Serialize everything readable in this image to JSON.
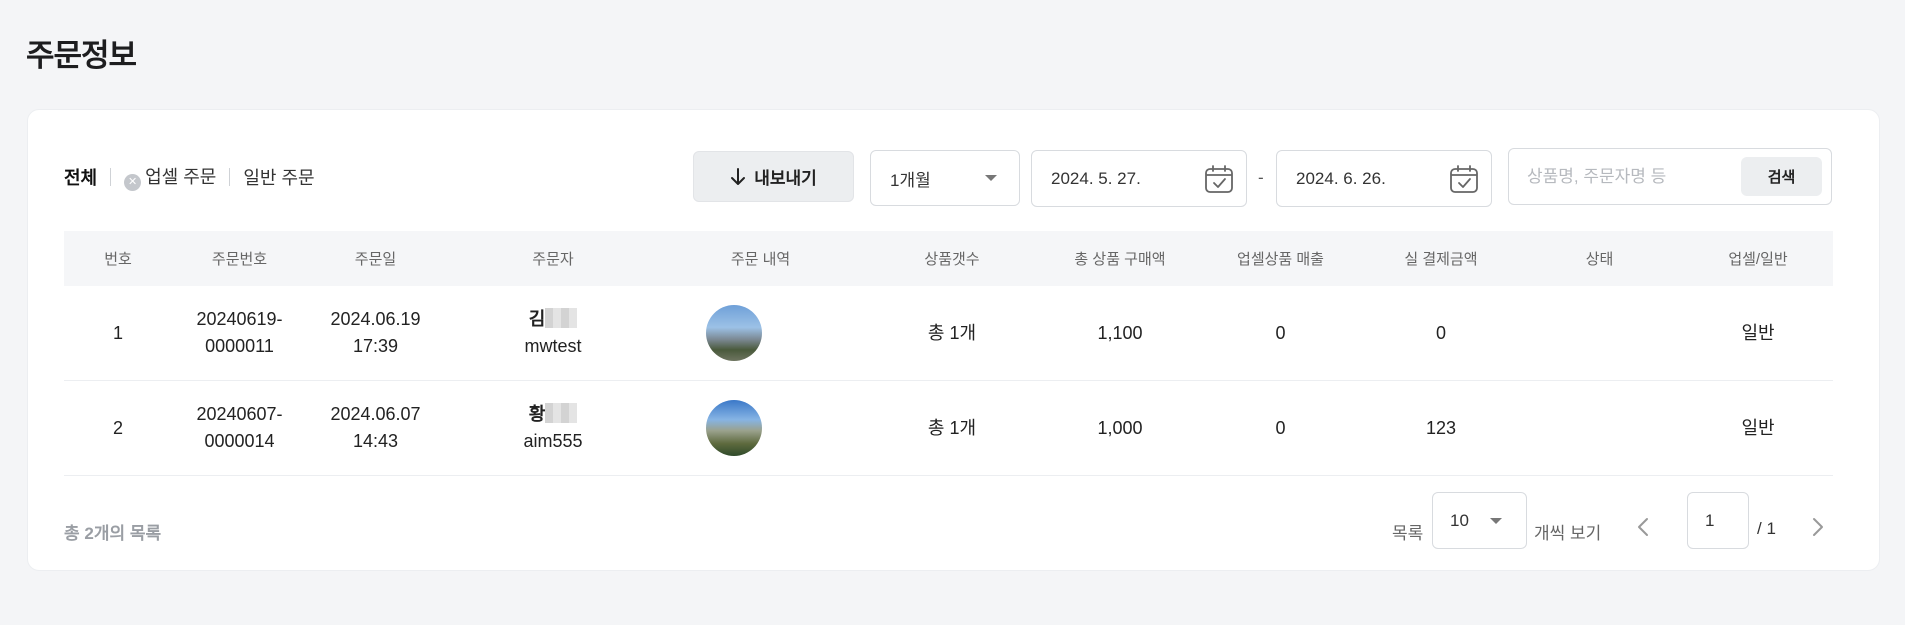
{
  "page": {
    "title": "주문정보"
  },
  "filters": {
    "tabs": [
      {
        "label": "전체",
        "active": true
      },
      {
        "label": "업셀 주문",
        "icon": "upsell-icon"
      },
      {
        "label": "일반 주문"
      }
    ]
  },
  "toolbar": {
    "export_label": "내보내기",
    "export_icon": "arrow-down-icon",
    "period_value": "1개월",
    "date_start": "2024. 5. 27.",
    "date_end": "2024. 6. 26.",
    "date_separator": "-",
    "search_placeholder": "상품명, 주문자명 등",
    "search_value": "",
    "search_button": "검색"
  },
  "table": {
    "columns": [
      "번호",
      "주문번호",
      "주문일",
      "주문자",
      "주문 내역",
      "상품갯수",
      "총 상품 구매액",
      "업셀상품 매출",
      "실 결제금액",
      "상태",
      "업셀/일반"
    ],
    "rows": [
      {
        "no": "1",
        "order_no_line1": "20240619-",
        "order_no_line2": "0000011",
        "date": "2024.06.19",
        "time": "17:39",
        "buyer_name": "김",
        "buyer_id": "mwtest",
        "count": "총 1개",
        "total": "1,100",
        "upsell_sales": "0",
        "paid": "0",
        "status": "",
        "type": "일반"
      },
      {
        "no": "2",
        "order_no_line1": "20240607-",
        "order_no_line2": "0000014",
        "date": "2024.06.07",
        "time": "14:43",
        "buyer_name": "황",
        "buyer_id": "aim555",
        "count": "총 1개",
        "total": "1,000",
        "upsell_sales": "0",
        "paid": "123",
        "status": "",
        "type": "일반"
      }
    ]
  },
  "footer": {
    "total_text": "총 2개의 목록",
    "page_size_label": "목록",
    "page_size_value": "10",
    "per_page_label": "개씩 보기",
    "current_page": "1",
    "total_pages": "/ 1"
  },
  "colors": {
    "background": "#f4f5f7",
    "card": "#ffffff",
    "header_row": "#f5f6f8"
  }
}
